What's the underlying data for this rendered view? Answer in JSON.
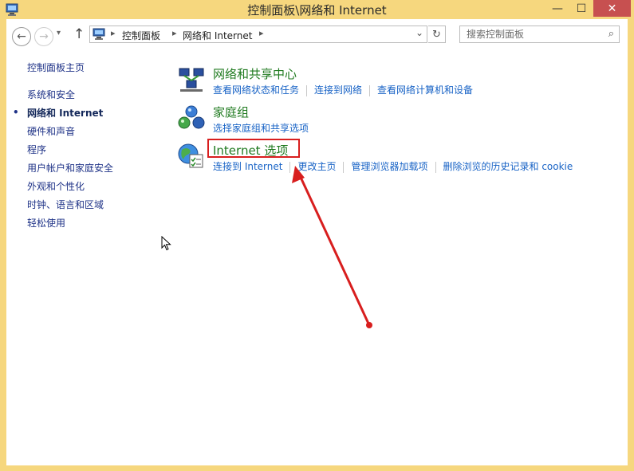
{
  "window": {
    "title": "控制面板\\网络和 Internet",
    "min_label": "—",
    "max_label": "☐",
    "close_label": "✕"
  },
  "nav": {
    "back": "←",
    "forward": "→",
    "recent": "▾",
    "up": "↑",
    "address_crumbs": [
      "控制面板",
      "网络和 Internet"
    ],
    "dropdown": "⌄",
    "refresh": "↻",
    "search_placeholder": "搜索控制面板",
    "search_icon": "⌕"
  },
  "sidebar": {
    "home": "控制面板主页",
    "items": [
      {
        "label": "系统和安全",
        "active": false
      },
      {
        "label": "网络和 Internet",
        "active": true
      },
      {
        "label": "硬件和声音",
        "active": false
      },
      {
        "label": "程序",
        "active": false
      },
      {
        "label": "用户帐户和家庭安全",
        "active": false
      },
      {
        "label": "外观和个性化",
        "active": false
      },
      {
        "label": "时钟、语言和区域",
        "active": false
      },
      {
        "label": "轻松使用",
        "active": false
      }
    ],
    "bullet": "•"
  },
  "categories": [
    {
      "title": "网络和共享中心",
      "icon": "network-sharing-icon",
      "links": [
        "查看网络状态和任务",
        "连接到网络",
        "查看网络计算机和设备"
      ]
    },
    {
      "title": "家庭组",
      "icon": "homegroup-icon",
      "links": [
        "选择家庭组和共享选项"
      ]
    },
    {
      "title": "Internet 选项",
      "icon": "internet-options-icon",
      "links": [
        "连接到 Internet",
        "更改主页",
        "管理浏览器加载项",
        "删除浏览的历史记录和 cookie"
      ]
    }
  ],
  "colors": {
    "frame": "#f6d77e",
    "link_blue": "#1863c6",
    "title_green": "#1f7a1f",
    "annotation_red": "#d81e1e"
  }
}
